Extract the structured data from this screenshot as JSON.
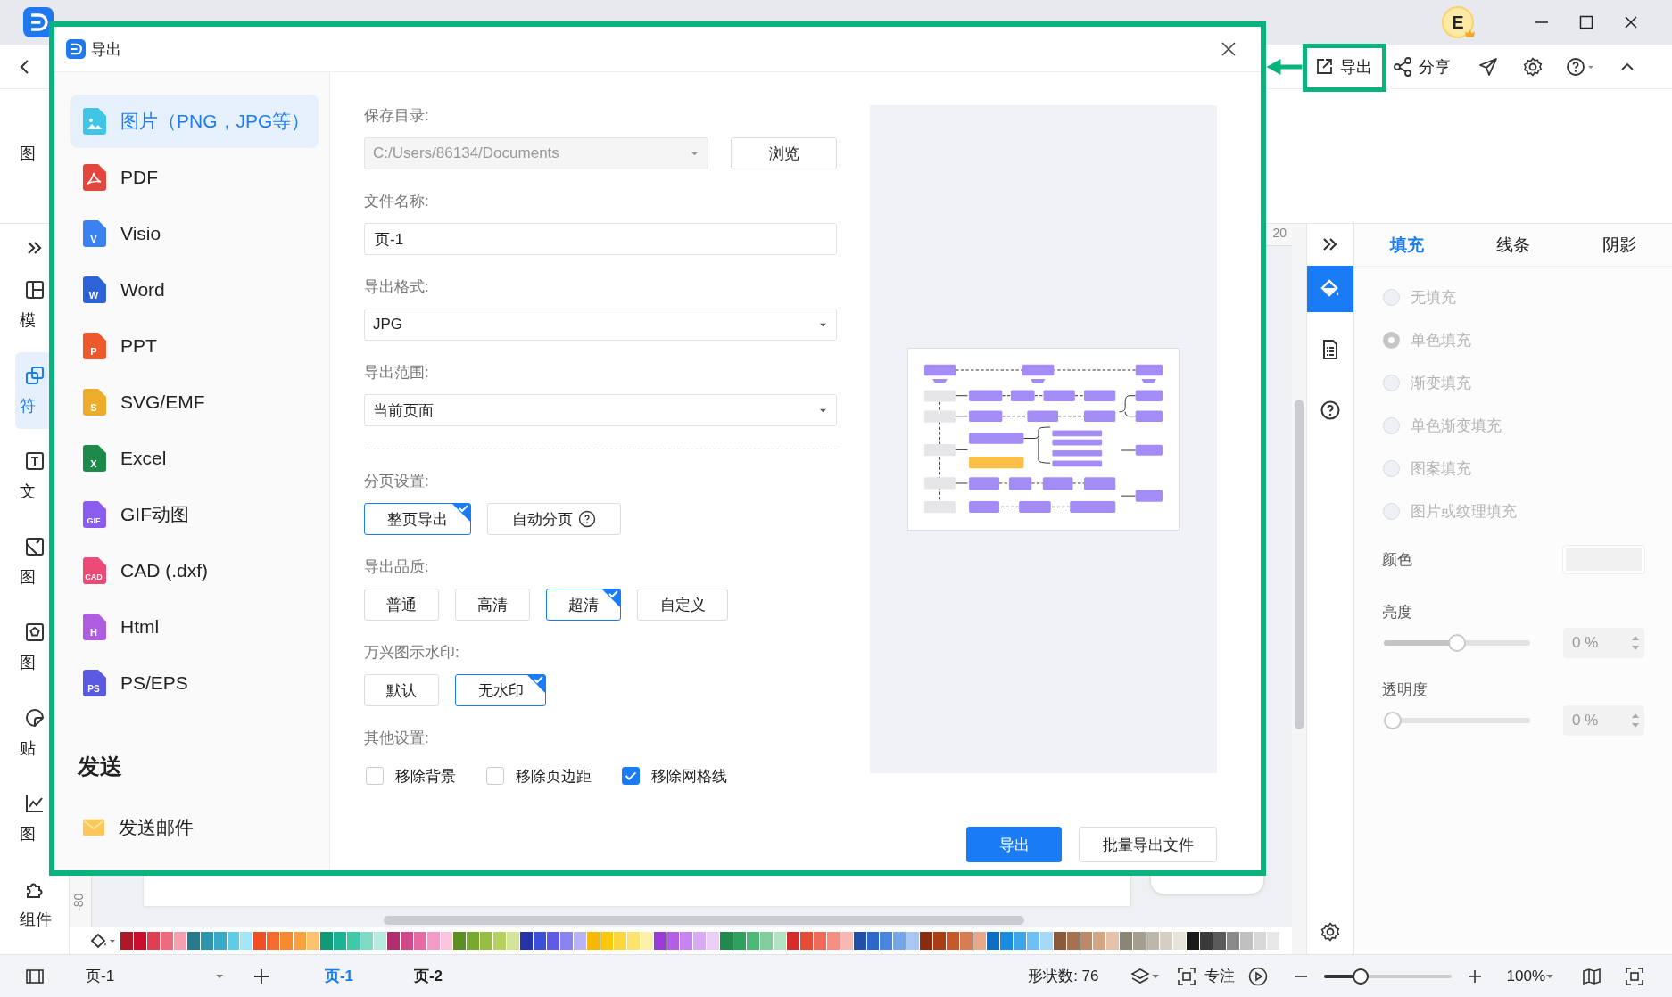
{
  "top_bar": {
    "avatar": "E"
  },
  "toolbar": {
    "export": "导出",
    "share": "分享"
  },
  "ribbon": {
    "label": "图"
  },
  "sidebar": {
    "items": [
      {
        "kind": "template",
        "label": "模",
        "selected": false
      },
      {
        "kind": "shapes",
        "label": "符",
        "selected": true
      },
      {
        "kind": "text",
        "label": "文",
        "selected": false
      },
      {
        "kind": "image",
        "label": "图",
        "selected": false
      },
      {
        "kind": "iconset",
        "label": "图",
        "selected": false
      },
      {
        "kind": "sticker",
        "label": "贴",
        "selected": false
      },
      {
        "kind": "chart",
        "label": "图",
        "selected": false
      },
      {
        "kind": "component",
        "label": "组件",
        "selected": false
      }
    ]
  },
  "canvas": {
    "top_ruler_label": "20",
    "left_ruler_label": "-80"
  },
  "palette": {
    "swatches": [
      {
        "color": "#b0182a"
      },
      {
        "color": "#c8102e"
      },
      {
        "color": "#e03e52"
      },
      {
        "color": "#ee6b7d"
      },
      {
        "color": "#f5a0ac"
      },
      {
        "color": "#2b7a8c"
      },
      {
        "color": "#2e95a8"
      },
      {
        "color": "#38aac8"
      },
      {
        "color": "#5dcce6"
      },
      {
        "color": "#a3e6f5"
      },
      {
        "color": "#f04e23"
      },
      {
        "color": "#f56a2f"
      },
      {
        "color": "#f7892e"
      },
      {
        "color": "#f9a03f"
      },
      {
        "color": "#fbc270"
      },
      {
        "color": "#0f9b74"
      },
      {
        "color": "#1ab394"
      },
      {
        "color": "#3ec9a7"
      },
      {
        "color": "#7fdcc4"
      },
      {
        "color": "#b5ecdd"
      },
      {
        "color": "#b0306e"
      },
      {
        "color": "#d0488a"
      },
      {
        "color": "#e36ba5"
      },
      {
        "color": "#f39ac5"
      },
      {
        "color": "#f9c6de"
      },
      {
        "color": "#5b8f22"
      },
      {
        "color": "#78a832"
      },
      {
        "color": "#97bd45"
      },
      {
        "color": "#b5d25c"
      },
      {
        "color": "#d3e59a"
      },
      {
        "color": "#2632a8"
      },
      {
        "color": "#3d4fd6"
      },
      {
        "color": "#5f5be8"
      },
      {
        "color": "#8a84f0"
      },
      {
        "color": "#b7b3f6"
      },
      {
        "color": "#f6b800"
      },
      {
        "color": "#f9c80e"
      },
      {
        "color": "#fbd640"
      },
      {
        "color": "#fce36e"
      },
      {
        "color": "#fdf0a8"
      },
      {
        "color": "#9b39d9"
      },
      {
        "color": "#b45ee6"
      },
      {
        "color": "#c783ee"
      },
      {
        "color": "#d9a9f3"
      },
      {
        "color": "#ead0f8"
      },
      {
        "color": "#1f8a4c"
      },
      {
        "color": "#2fa05e"
      },
      {
        "color": "#4fb878"
      },
      {
        "color": "#7fce9c"
      },
      {
        "color": "#b2e3c3"
      },
      {
        "color": "#d52b2b"
      },
      {
        "color": "#e84a3a"
      },
      {
        "color": "#f06a5a"
      },
      {
        "color": "#f58f84"
      },
      {
        "color": "#f9b8b1"
      },
      {
        "color": "#1f4fa8"
      },
      {
        "color": "#2c68c9"
      },
      {
        "color": "#4a86dd"
      },
      {
        "color": "#76a6ea"
      },
      {
        "color": "#a9c7f3"
      },
      {
        "color": "#8a2a0e"
      },
      {
        "color": "#a83e15"
      },
      {
        "color": "#c45a2c"
      },
      {
        "color": "#d97c52"
      },
      {
        "color": "#e9a88a"
      },
      {
        "color": "#0d6fc4"
      },
      {
        "color": "#1a8ce0"
      },
      {
        "color": "#3ba6ec"
      },
      {
        "color": "#6fc0f2"
      },
      {
        "color": "#a6d9f7"
      },
      {
        "color": "#8b5a3c"
      },
      {
        "color": "#a5714f"
      },
      {
        "color": "#bd8a67"
      },
      {
        "color": "#d2a584"
      },
      {
        "color": "#e4c3a8"
      },
      {
        "color": "#8c8577"
      },
      {
        "color": "#a59e8f"
      },
      {
        "color": "#bdb7a9"
      },
      {
        "color": "#d4cfc3"
      },
      {
        "color": "#e8e4da"
      },
      {
        "color": "#1a1a1a"
      },
      {
        "color": "#3a3a3a"
      },
      {
        "color": "#5a5a5a"
      },
      {
        "color": "#8a8a8a"
      },
      {
        "color": "#c0c0c0"
      },
      {
        "color": "#d8d8d8"
      },
      {
        "color": "#e8e8e8"
      }
    ]
  },
  "right_panel": {
    "side_icons": [
      {
        "kind": "fill",
        "selected": true
      },
      {
        "kind": "document",
        "selected": false
      },
      {
        "kind": "help",
        "selected": false
      }
    ],
    "tabs": [
      {
        "label": "填充",
        "selected": true
      },
      {
        "label": "线条",
        "selected": false
      },
      {
        "label": "阴影",
        "selected": false
      }
    ],
    "fill_options": [
      {
        "label": "无填充",
        "selected": false,
        "disabled": true
      },
      {
        "label": "单色填充",
        "selected": true,
        "disabled": true
      },
      {
        "label": "渐变填充",
        "selected": false,
        "disabled": true
      },
      {
        "label": "单色渐变填充",
        "selected": false,
        "disabled": true
      },
      {
        "label": "图案填充",
        "selected": false,
        "disabled": true
      },
      {
        "label": "图片或纹理填充",
        "selected": false,
        "disabled": true
      }
    ],
    "color_label": "颜色",
    "sliders": [
      {
        "label": "亮度",
        "level": 0.5,
        "value": "0 %"
      },
      {
        "label": "透明度",
        "level": 0,
        "value": "0 %"
      }
    ]
  },
  "status_bar": {
    "page_select": "页-1",
    "pages": [
      {
        "label": "页-1",
        "selected": true
      },
      {
        "label": "页-2",
        "selected": false
      }
    ],
    "shape_count": "形状数: 76",
    "focus": "专注",
    "zoom": {
      "level": 0.26
    },
    "zoom_value": "100%"
  },
  "dialog": {
    "title": "导出",
    "formats": [
      {
        "label": "图片（PNG，JPG等）",
        "kind": "image",
        "color": "#3fc6e6",
        "selected": true
      },
      {
        "label": "PDF",
        "kind": "pdf",
        "color": "#e2463c",
        "selected": false
      },
      {
        "label": "Visio",
        "kind": "file",
        "badge": "V",
        "color": "#3b82f0",
        "selected": false
      },
      {
        "label": "Word",
        "kind": "file",
        "badge": "W",
        "color": "#2f62d6",
        "selected": false
      },
      {
        "label": "PPT",
        "kind": "file",
        "badge": "P",
        "color": "#ec5a2c",
        "selected": false
      },
      {
        "label": "SVG/EMF",
        "kind": "file",
        "badge": "S",
        "color": "#eeac2c",
        "selected": false
      },
      {
        "label": "Excel",
        "kind": "file",
        "badge": "X",
        "color": "#1e8a4a",
        "selected": false
      },
      {
        "label": "GIF动图",
        "kind": "file",
        "badge": "GIF",
        "color": "#8b5cf0",
        "selected": false
      },
      {
        "label": "CAD (.dxf)",
        "kind": "file",
        "badge": "CAD",
        "color": "#ee4a78",
        "selected": false
      },
      {
        "label": "Html",
        "kind": "file",
        "badge": "H",
        "color": "#b05ce0",
        "selected": false
      },
      {
        "label": "PS/EPS",
        "kind": "file",
        "badge": "PS",
        "color": "#5a5ae0",
        "selected": false
      }
    ],
    "send_heading": "发送",
    "send_items": [
      {
        "label": "发送邮件"
      }
    ],
    "form": {
      "save_dir": {
        "label": "保存目录:",
        "value": "C:/Users/86134/Documents",
        "disabled": true,
        "browse": "浏览"
      },
      "file_name": {
        "label": "文件名称:",
        "value": "页-1"
      },
      "format": {
        "label": "导出格式:",
        "value": "JPG"
      },
      "range": {
        "label": "导出范围:",
        "value": "当前页面"
      },
      "paging": {
        "label": "分页设置:",
        "options": [
          {
            "label": "整页导出",
            "selected": true,
            "has_help": false
          },
          {
            "label": "自动分页",
            "selected": false,
            "has_help": true
          }
        ]
      },
      "quality": {
        "label": "导出品质:",
        "options": [
          {
            "label": "普通",
            "selected": false
          },
          {
            "label": "高清",
            "selected": false
          },
          {
            "label": "超清",
            "selected": true
          },
          {
            "label": "自定义",
            "selected": false
          }
        ]
      },
      "watermark": {
        "label": "万兴图示水印:",
        "options": [
          {
            "label": "默认",
            "selected": false
          },
          {
            "label": "无水印",
            "selected": true
          }
        ]
      },
      "other": {
        "label": "其他设置:",
        "checks": [
          {
            "label": "移除背景",
            "checked": false
          },
          {
            "label": "移除页边距",
            "checked": false
          },
          {
            "label": "移除网格线",
            "checked": true
          }
        ]
      }
    },
    "buttons": [
      {
        "label": "导出",
        "kind": "primary"
      },
      {
        "label": "批量导出文件",
        "kind": "secondary"
      }
    ]
  }
}
